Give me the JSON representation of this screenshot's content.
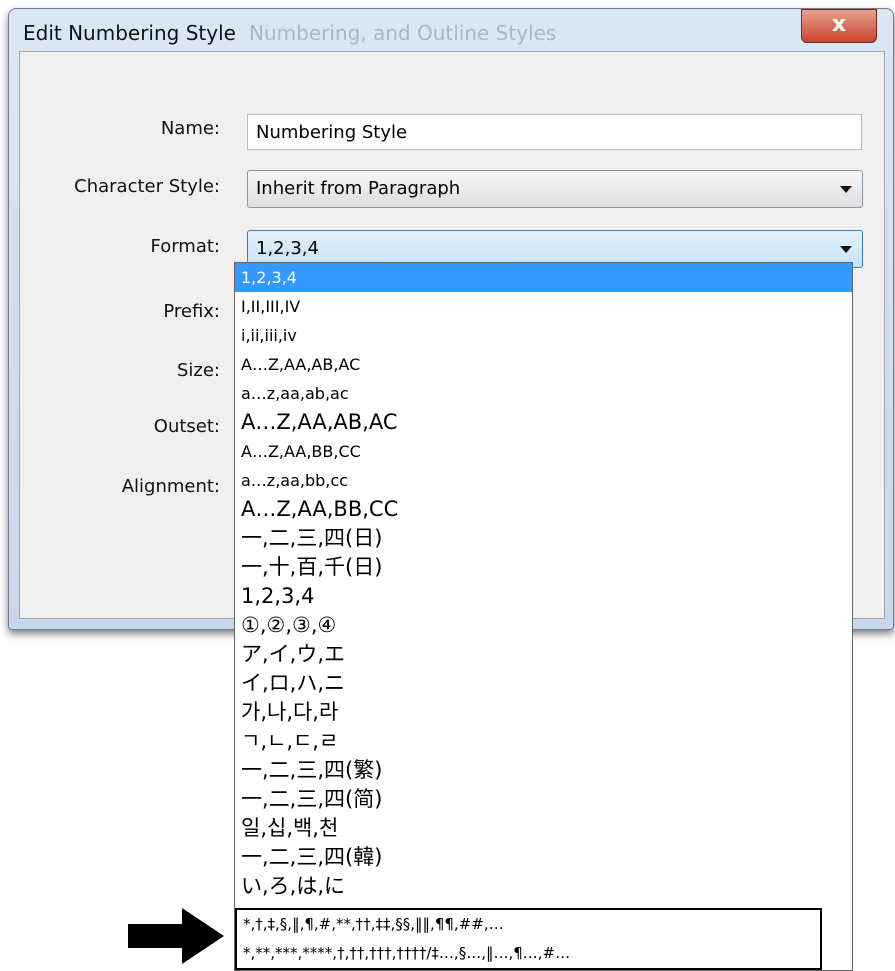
{
  "window": {
    "title": "Edit Numbering Style",
    "background_title": "Numbering, and Outline Styles",
    "close_glyph": "x"
  },
  "form": {
    "name_label": "Name:",
    "name_value": "Numbering Style",
    "character_style_label": "Character Style:",
    "character_style_value": "Inherit from Paragraph",
    "format_label": "Format:",
    "format_value": "1,2,3,4",
    "prefix_label": "Prefix:",
    "size_label": "Size:",
    "outset_label": "Outset:",
    "alignment_label": "Alignment:"
  },
  "format_options": [
    "1,2,3,4",
    "I,II,III,IV",
    "i,ii,iii,iv",
    "A…Z,AA,AB,AC",
    "a…z,aa,ab,ac",
    "A…Z,AA,AB,AC",
    "A…Z,AA,BB,CC",
    "a…z,aa,bb,cc",
    "A…Z,AA,BB,CC",
    "一,二,三,四(日)",
    "一,十,百,千(日)",
    "1,2,3,4",
    "①,②,③,④",
    "ア,イ,ウ,エ",
    "イ,ロ,ハ,ニ",
    "가,나,다,라",
    "ㄱ,ㄴ,ㄷ,ㄹ",
    "一,二,三,四(繁)",
    "一,二,三,四(简)",
    "일,십,백,천",
    "一,二,三,四(韓)",
    "い,ろ,は,に",
    "*,†,‡,§,‖,¶,#,**,††,‡‡,§§,‖‖,¶¶,##,…",
    "*,**,***,****,†,††,†††,††††/‡…,§…,‖…,¶…,#…"
  ],
  "colors": {
    "selection": "#3399ff",
    "window_frame": "#c7d8ea",
    "close_button": "#c8462f"
  },
  "icons": {
    "dropdown_arrow": "chevron-down-icon",
    "pointer": "arrow-right-icon"
  }
}
